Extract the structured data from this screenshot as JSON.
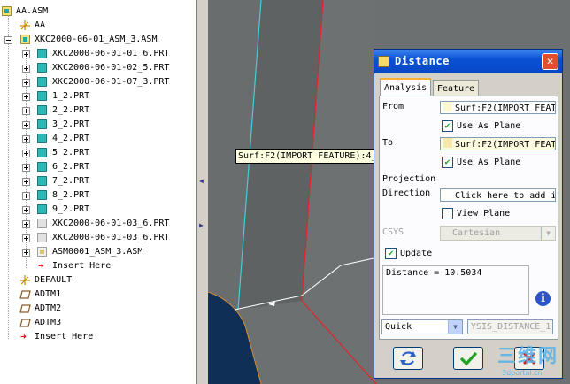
{
  "model_tree": {
    "root": "AA.ASM",
    "items": [
      {
        "label": "AA"
      },
      {
        "label": "XKC2000-06-01_ASM_3.ASM"
      },
      {
        "label": "XKC2000-06-01-01_6.PRT"
      },
      {
        "label": "XKC2000-06-01-02_5.PRT"
      },
      {
        "label": "XKC2000-06-01-07_3.PRT"
      },
      {
        "label": "1_2.PRT"
      },
      {
        "label": "2_2.PRT"
      },
      {
        "label": "3_2.PRT"
      },
      {
        "label": "4_2.PRT"
      },
      {
        "label": "5_2.PRT"
      },
      {
        "label": "6_2.PRT"
      },
      {
        "label": "7_2.PRT"
      },
      {
        "label": "8_2.PRT"
      },
      {
        "label": "9_2.PRT"
      },
      {
        "label": "XKC2000-06-01-03_6.PRT"
      },
      {
        "label": "XKC2000-06-01-03_6.PRT"
      },
      {
        "label": "ASM0001_ASM_3.ASM"
      },
      {
        "label": "Insert Here"
      },
      {
        "label": "DEFAULT"
      },
      {
        "label": "ADTM1"
      },
      {
        "label": "ADTM2"
      },
      {
        "label": "ADTM3"
      },
      {
        "label": "Insert Here"
      }
    ]
  },
  "graphics": {
    "tooltip": "Surf:F2(IMPORT FEATURE):4_2"
  },
  "dialog": {
    "title": "Distance",
    "close_glyph": "✕",
    "tabs": [
      {
        "label": "Analysis"
      },
      {
        "label": "Feature"
      }
    ],
    "from_label": "From",
    "from_value": "Surf:F2(IMPORT FEATU",
    "from_use_as_plane": "Use As Plane",
    "to_label": "To",
    "to_value": "Surf:F2(IMPORT FEAT",
    "to_use_as_plane": "Use As Plane",
    "projection_label": "Projection",
    "direction_label": "Direction",
    "direction_value": "Click here to add i",
    "view_plane": "View Plane",
    "csys_label": "CSYS",
    "csys_value": "Cartesian",
    "update_label": "Update",
    "result_text": "Distance = 10.5034",
    "info_glyph": "i",
    "mode_value": "Quick",
    "analysis_name": "YSIS_DISTANCE_1"
  },
  "watermark": {
    "text": "三维网",
    "url": "3dportal.cn"
  },
  "colors": {
    "titlebar": "#0a51d5",
    "graphics_bg": "#6d7071",
    "tab_highlight": "#f6b133",
    "part_icon": "#2ab9b7",
    "insert_arrow": "#e00000"
  }
}
